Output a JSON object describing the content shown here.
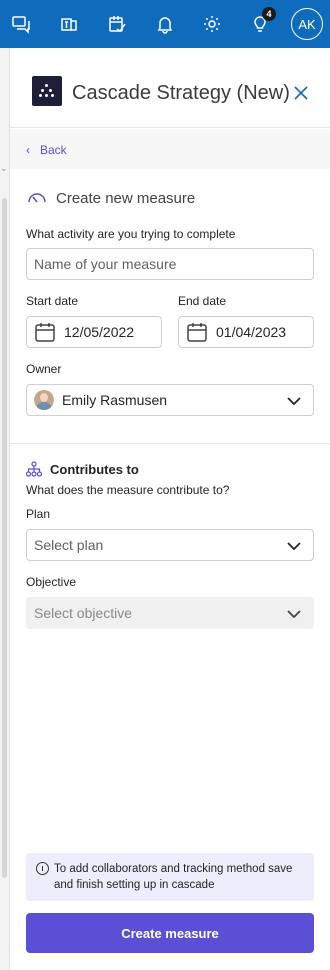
{
  "topbar": {
    "badge_count": "4",
    "user_initials": "AK",
    "icons": [
      "chat-icon",
      "teams-icon",
      "tasks-icon",
      "bell-icon",
      "gear-icon",
      "lightbulb-icon"
    ]
  },
  "pane": {
    "title": "Cascade Strategy (New)",
    "back_label": "Back"
  },
  "measure": {
    "heading": "Create new measure",
    "activity_label": "What activity are you trying to complete",
    "name_placeholder": "Name of your measure",
    "start_label": "Start date",
    "start_value": "12/05/2022",
    "end_label": "End date",
    "end_value": "01/04/2023",
    "owner_label": "Owner",
    "owner_value": "Emily Rasmusen"
  },
  "contributes": {
    "heading": "Contributes to",
    "subheading": "What does the measure contribute to?",
    "plan_label": "Plan",
    "plan_placeholder": "Select plan",
    "objective_label": "Objective",
    "objective_placeholder": "Select objective"
  },
  "footer": {
    "info_text": "To add collaborators and tracking method save and finish setting up in cascade",
    "create_label": "Create measure"
  },
  "colors": {
    "topbar": "#0f6cbd",
    "accent": "#5b4fd6",
    "info_bg": "#eeedfc"
  }
}
